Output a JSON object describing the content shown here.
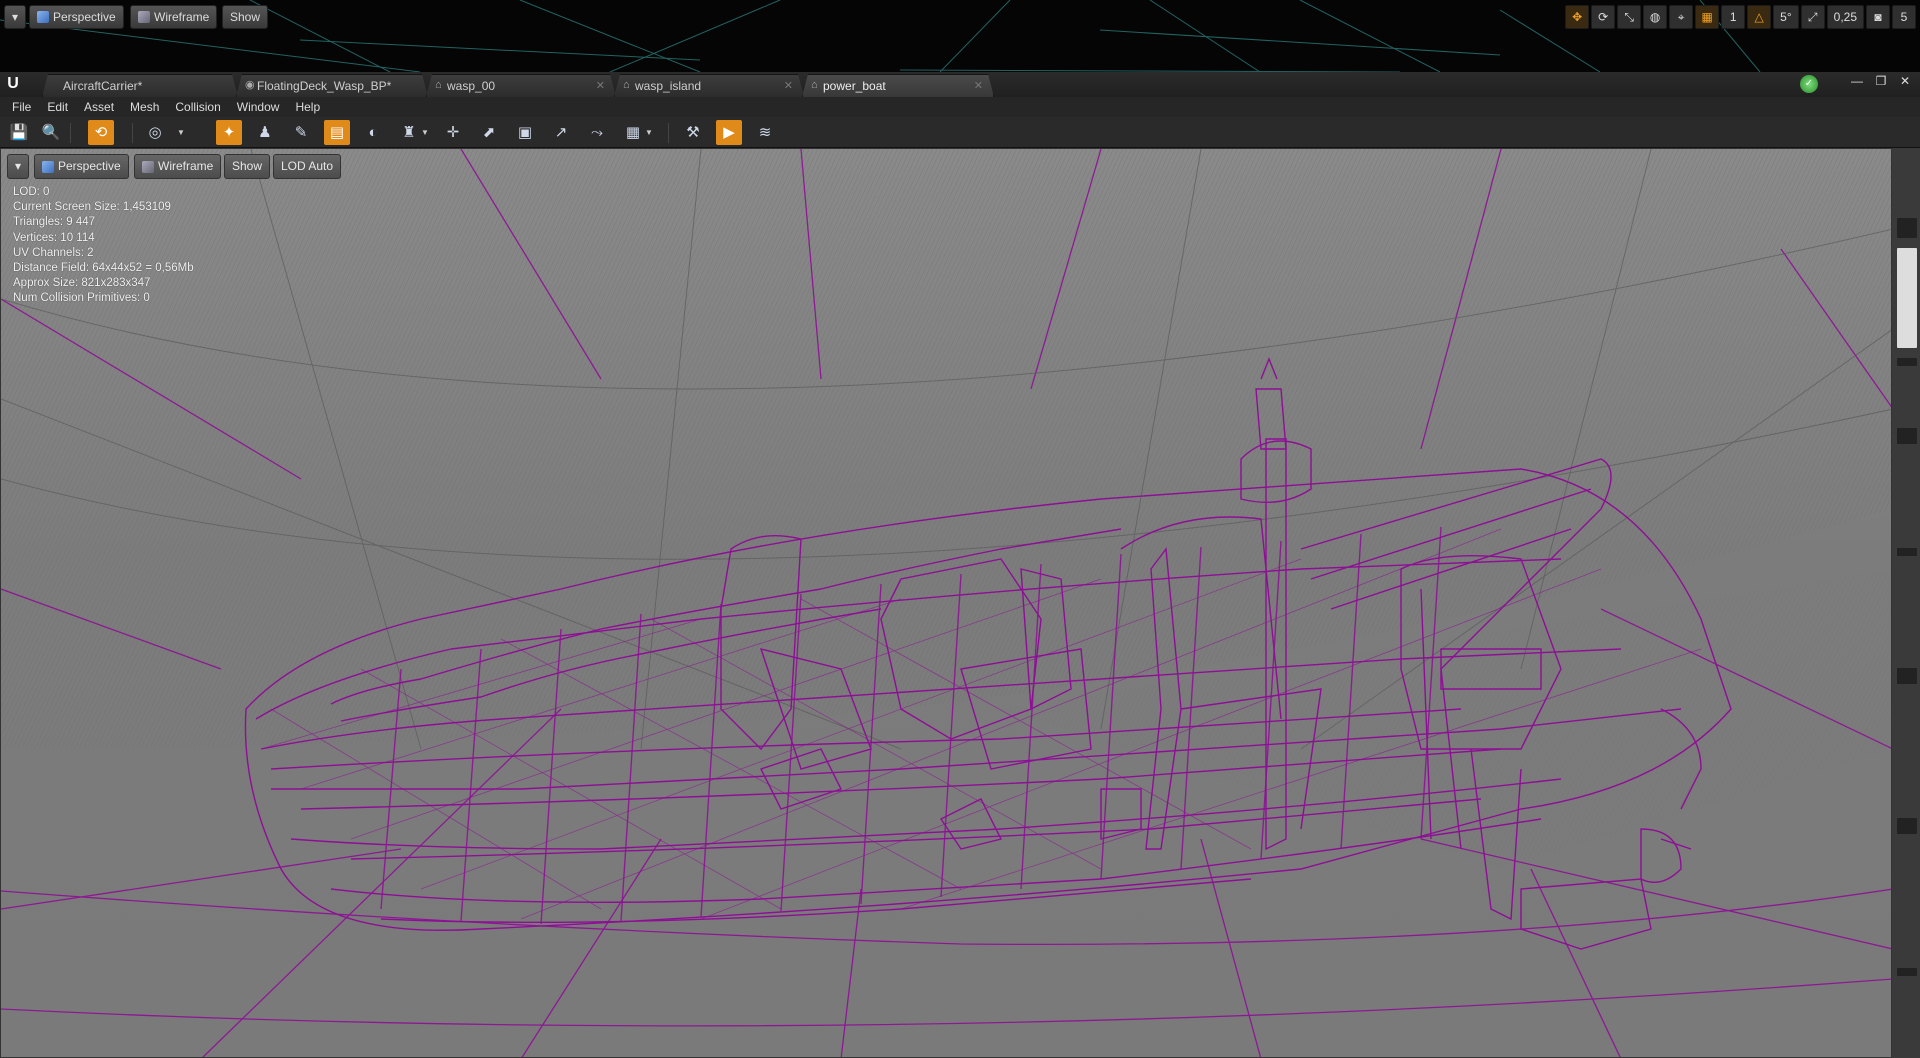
{
  "bg_viewport": {
    "perspective_label": "Perspective",
    "wireframe_label": "Wireframe",
    "show_label": "Show",
    "tools": {
      "grid_snap_value": "1",
      "rotation_snap_value": "5°",
      "scale_snap_value": "0,25",
      "camera_speed_value": "5"
    }
  },
  "tabs": [
    {
      "label": "AircraftCarrier*",
      "icon": "level-icon"
    },
    {
      "label": "FloatingDeck_Wasp_BP*",
      "icon": "blueprint-icon"
    },
    {
      "label": "wasp_00",
      "icon": "static-mesh-icon"
    },
    {
      "label": "wasp_island",
      "icon": "static-mesh-icon"
    },
    {
      "label": "power_boat",
      "icon": "static-mesh-icon"
    }
  ],
  "menu": [
    "File",
    "Edit",
    "Asset",
    "Mesh",
    "Collision",
    "Window",
    "Help"
  ],
  "viewport": {
    "perspective_label": "Perspective",
    "wireframe_label": "Wireframe",
    "show_label": "Show",
    "lod_label": "LOD Auto"
  },
  "stats": [
    "LOD:  0",
    "Current Screen Size:  1,453109",
    "Triangles:  9 447",
    "Vertices:  10 114",
    "UV Channels:  2",
    "Distance Field:  64x44x52 = 0,56Mb",
    "Approx Size: 821x283x347",
    "Num Collision Primitives:  0"
  ],
  "colors": {
    "wireframe": "#8e0f96",
    "viewport_bg": "#7e7e7e",
    "accent": "#e08a1a"
  }
}
